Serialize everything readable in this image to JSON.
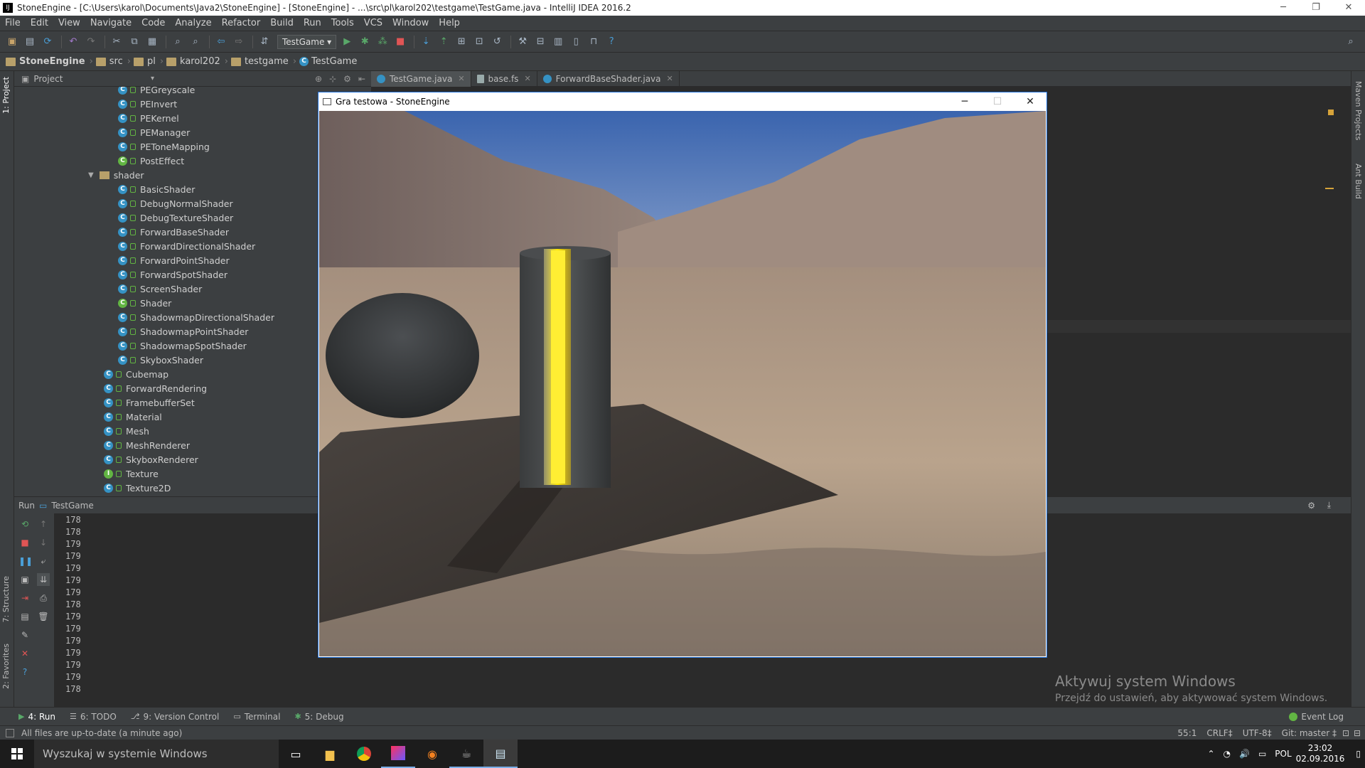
{
  "window": {
    "title": "StoneEngine - [C:\\Users\\karol\\Documents\\Java2\\StoneEngine] - [StoneEngine] - ...\\src\\pl\\karol202\\testgame\\TestGame.java - IntelliJ IDEA 2016.2",
    "minimize": "─",
    "restore": "❐",
    "close": "✕"
  },
  "menu": [
    "File",
    "Edit",
    "View",
    "Navigate",
    "Code",
    "Analyze",
    "Refactor",
    "Build",
    "Run",
    "Tools",
    "VCS",
    "Window",
    "Help"
  ],
  "toolbar": {
    "run_config": "TestGame ▾"
  },
  "breadcrumb": [
    "StoneEngine",
    "src",
    "pl",
    "karol202",
    "testgame",
    "TestGame"
  ],
  "project_panel": {
    "title": "Project",
    "items": [
      {
        "label": "PEGreyscale",
        "kind": "class"
      },
      {
        "label": "PEInvert",
        "kind": "class"
      },
      {
        "label": "PEKernel",
        "kind": "class"
      },
      {
        "label": "PEManager",
        "kind": "class"
      },
      {
        "label": "PEToneMapping",
        "kind": "class"
      },
      {
        "label": "PostEffect",
        "kind": "abstract"
      },
      {
        "label": "shader",
        "kind": "folder"
      },
      {
        "label": "BasicShader",
        "kind": "class"
      },
      {
        "label": "DebugNormalShader",
        "kind": "class"
      },
      {
        "label": "DebugTextureShader",
        "kind": "class"
      },
      {
        "label": "ForwardBaseShader",
        "kind": "class"
      },
      {
        "label": "ForwardDirectionalShader",
        "kind": "class"
      },
      {
        "label": "ForwardPointShader",
        "kind": "class"
      },
      {
        "label": "ForwardSpotShader",
        "kind": "class"
      },
      {
        "label": "ScreenShader",
        "kind": "class"
      },
      {
        "label": "Shader",
        "kind": "abstract"
      },
      {
        "label": "ShadowmapDirectionalShader",
        "kind": "class"
      },
      {
        "label": "ShadowmapPointShader",
        "kind": "class"
      },
      {
        "label": "ShadowmapSpotShader",
        "kind": "class"
      },
      {
        "label": "SkyboxShader",
        "kind": "class"
      },
      {
        "label": "Cubemap",
        "kind": "class"
      },
      {
        "label": "ForwardRendering",
        "kind": "class"
      },
      {
        "label": "FramebufferSet",
        "kind": "class"
      },
      {
        "label": "Material",
        "kind": "class"
      },
      {
        "label": "Mesh",
        "kind": "class"
      },
      {
        "label": "MeshRenderer",
        "kind": "class"
      },
      {
        "label": "SkyboxRenderer",
        "kind": "class"
      },
      {
        "label": "Texture",
        "kind": "interface"
      },
      {
        "label": "Texture2D",
        "kind": "class"
      }
    ]
  },
  "editor_tabs": [
    {
      "label": "TestGame.java",
      "active": true
    },
    {
      "label": "base.fs",
      "active": false
    },
    {
      "label": "ForwardBaseShader.java",
      "active": false
    }
  ],
  "run_panel": {
    "label": "Run",
    "config": "TestGame",
    "output": [
      "178",
      "178",
      "179",
      "179",
      "179",
      "179",
      "179",
      "178",
      "179",
      "179",
      "179",
      "179",
      "179",
      "179",
      "178"
    ]
  },
  "game_window": {
    "title": "Gra testowa - StoneEngine"
  },
  "side_tabs": {
    "project": "1: Project",
    "structure": "7: Structure",
    "favorites": "2: Favorites",
    "maven": "Maven Projects",
    "ant": "Ant Build"
  },
  "bottom_tabs": [
    {
      "label": "4: Run",
      "icon": "▶",
      "active": true
    },
    {
      "label": "6: TODO",
      "icon": "☰",
      "active": false
    },
    {
      "label": "9: Version Control",
      "icon": "⎇",
      "active": false
    },
    {
      "label": "Terminal",
      "icon": "▭",
      "active": false
    },
    {
      "label": "5: Debug",
      "icon": "✱",
      "active": false
    }
  ],
  "event_log": "Event Log",
  "status": {
    "message": "All files are up-to-date (a minute ago)",
    "position": "55:1",
    "line_sep": "CRLF‡",
    "encoding": "UTF-8‡",
    "git": "Git: master ‡"
  },
  "watermark": {
    "line1": "Aktywuj system Windows",
    "line2": "Przejdź do ustawień, aby aktywować system Windows."
  },
  "taskbar": {
    "search_placeholder": "Wyszukaj w systemie Windows",
    "lang": "POL",
    "time": "23:02",
    "date": "02.09.2016"
  },
  "colors": {
    "accent": "#1e6fd9",
    "ide_bg": "#2b2b2b",
    "panel": "#3c3f41",
    "class_icon": "#3592c4",
    "green": "#62b543",
    "glow": "#ffe800"
  }
}
